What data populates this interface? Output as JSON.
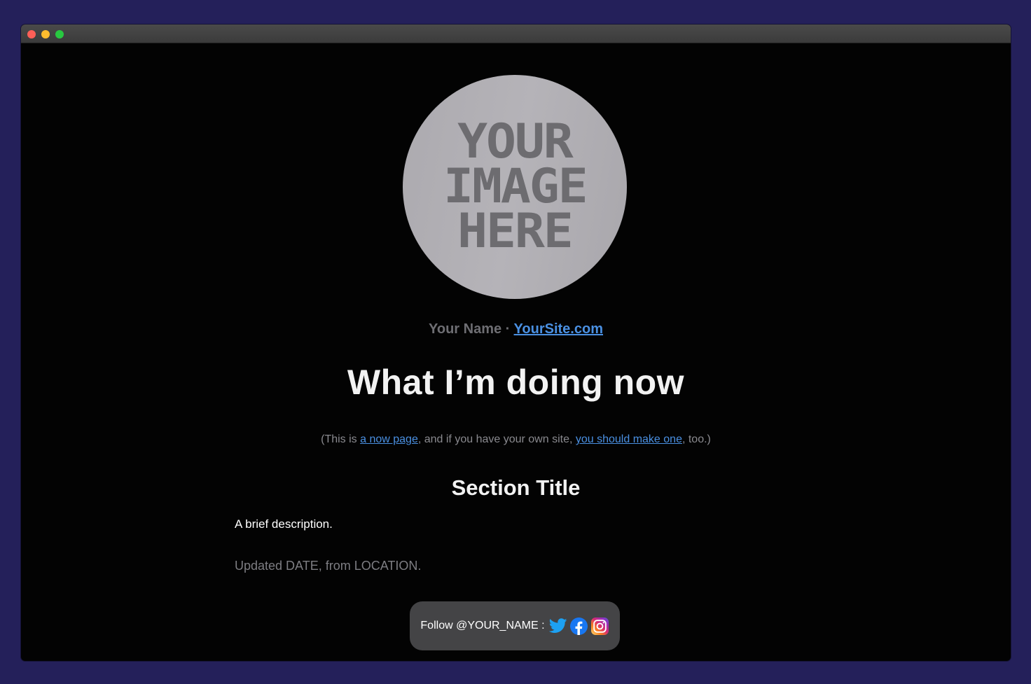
{
  "avatar": {
    "line1": "YOUR",
    "line2": "IMAGE",
    "line3": "HERE"
  },
  "byline": {
    "name": "Your Name",
    "separator": "·",
    "site_link": "YourSite.com"
  },
  "headline": "What I’m doing now",
  "note": {
    "prefix": "(This is ",
    "link1": "a now page",
    "middle": ", and if you have your own site, ",
    "link2": "you should make one",
    "suffix": ", too.)"
  },
  "section": {
    "title": "Section Title",
    "description": "A brief description."
  },
  "updated": "Updated DATE, from LOCATION.",
  "follow": {
    "label": "Follow @YOUR_NAME :",
    "icons": [
      "twitter-icon",
      "facebook-icon",
      "instagram-icon"
    ]
  },
  "colors": {
    "page_background": "#24205a",
    "window_background": "#030303",
    "link": "#4a90e2",
    "follow_box": "#444446"
  }
}
